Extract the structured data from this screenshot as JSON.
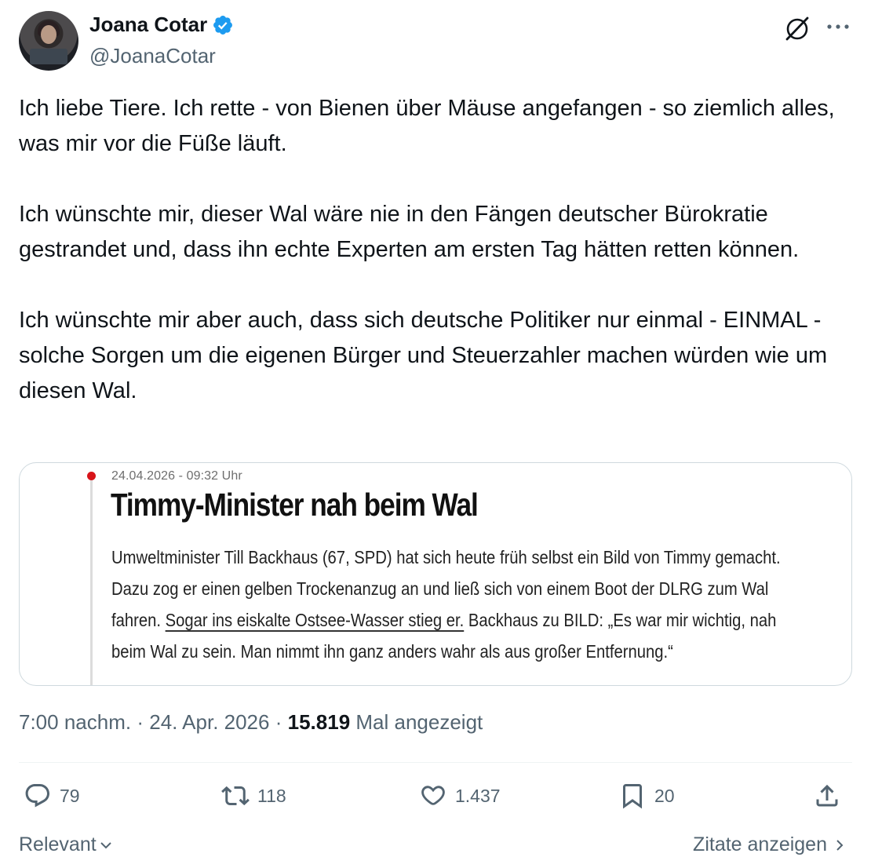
{
  "author": {
    "display_name": "Joana Cotar",
    "handle": "@JoanaCotar",
    "verified": true
  },
  "colors": {
    "verified_badge": "#1d9bf0",
    "text_primary": "#0f1419",
    "text_secondary": "#536471",
    "border": "#cfd9de",
    "bild_red": "#d8141a"
  },
  "icons": {
    "grok": "grok-icon",
    "more": "more-icon",
    "reply": "reply-icon",
    "retweet": "retweet-icon",
    "like": "heart-icon",
    "bookmark": "bookmark-icon",
    "share": "share-icon"
  },
  "tweet": {
    "paragraphs": [
      "Ich liebe Tiere. Ich rette - von Bienen über Mäuse angefangen - so ziemlich alles, was mir vor die Füße läuft.",
      "Ich wünschte mir, dieser Wal wäre nie in den Fängen deutscher Bürokratie gestrandet und, dass ihn echte Experten am ersten Tag hätten retten können.",
      "Ich wünschte mir aber auch, dass sich deutsche Politiker nur einmal - EINMAL - solche Sorgen um die eigenen Bürger und Steuerzahler machen würden wie um diesen Wal."
    ]
  },
  "media": {
    "date": "24.04.2026 - 09:32 Uhr",
    "headline": "Timmy-Minister nah beim Wal",
    "body_before": "Umweltminister Till Backhaus (67, SPD) hat sich heute früh selbst ein Bild von Timmy gemacht. Dazu zog er einen gelben Trockenanzug an und ließ sich von einem Boot der DLRG zum Wal fahren. ",
    "body_link": "Sogar ins eiskalte Ostsee-Wasser stieg er.",
    "body_after": " Backhaus zu BILD: „Es war mir wichtig, nah beim Wal zu sein. Man nimmt ihn ganz anders wahr als aus großer Entfernung.“"
  },
  "meta": {
    "time": "7:00 nachm.",
    "separator": "·",
    "date": "24. Apr. 2026",
    "views": "15.819",
    "views_label": "Mal angezeigt"
  },
  "actions": {
    "replies": "79",
    "retweets": "118",
    "likes": "1.437",
    "bookmarks": "20"
  },
  "footer": {
    "sort_label": "Relevant",
    "quotes_label": "Zitate anzeigen"
  }
}
